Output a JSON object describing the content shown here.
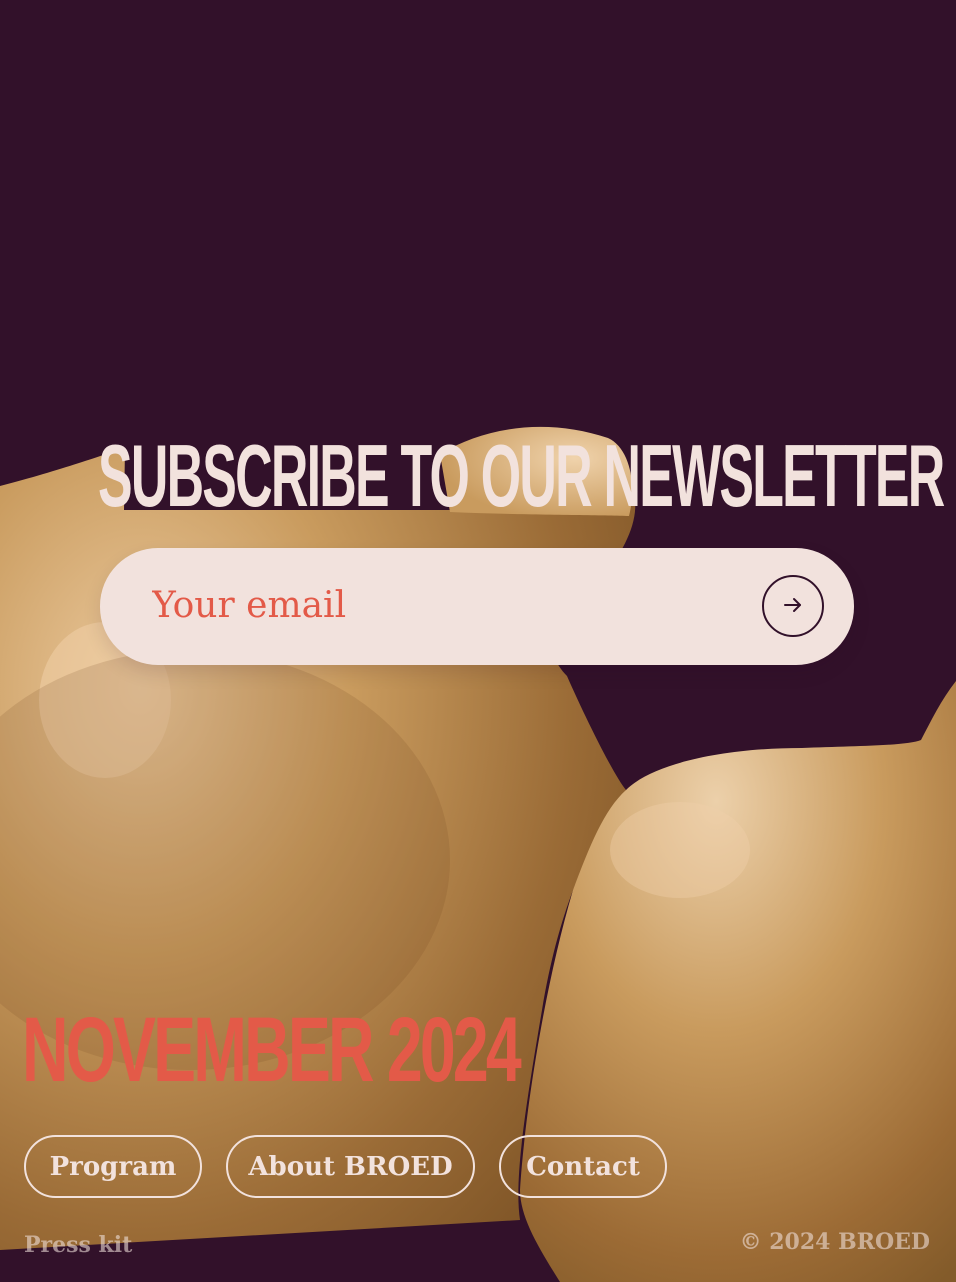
{
  "newsletter": {
    "title": "SUBSCRIBE TO OUR NEWSLETTER",
    "email_placeholder": "Your email",
    "submit_icon": "arrow-right-icon"
  },
  "event": {
    "date": "NOVEMBER 2024"
  },
  "footer": {
    "nav": [
      {
        "label": "Program"
      },
      {
        "label": "About BROED"
      },
      {
        "label": "Contact"
      }
    ],
    "press_kit": "Press kit",
    "copyright": "© 2024 BROED"
  },
  "colors": {
    "background": "#32112a",
    "cream": "#f2e2dd",
    "accent": "#e35a48",
    "sculpture": "#c99b5e"
  }
}
